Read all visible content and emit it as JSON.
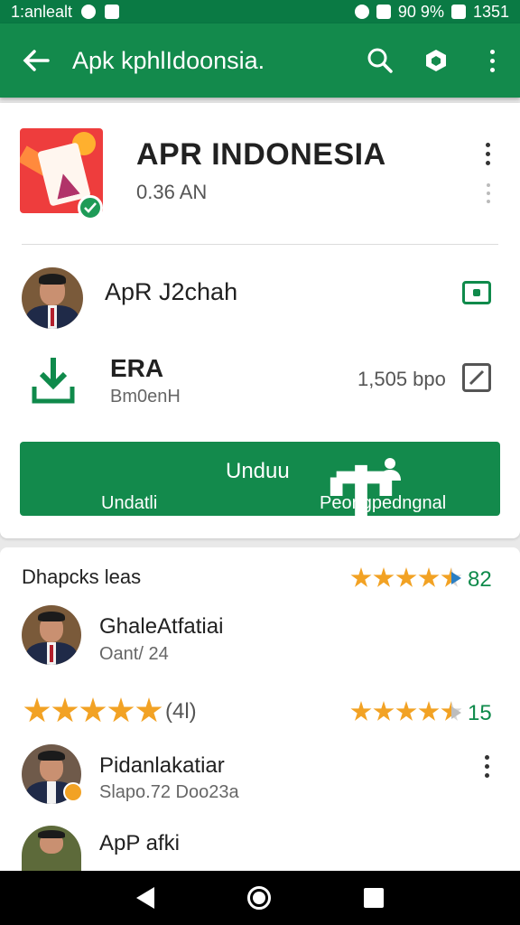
{
  "status_bar": {
    "carrier": "1:anlealt",
    "battery_percent": "90 9%",
    "time": "1351"
  },
  "app_bar": {
    "title": "Apk kphlIdoonsia."
  },
  "app": {
    "title": "APR  INDONESIA",
    "subtitle": "0.36 AN"
  },
  "developer": {
    "name": "ApR J2chah"
  },
  "download": {
    "title": "ERA",
    "subtitle": "Bm0enH",
    "size": "1,505 bpo"
  },
  "install_button": {
    "main_label": "Unduu",
    "left_label": "Undatli",
    "right_label": "Peongpedngnal"
  },
  "ratings": {
    "section_title": "Dhapcks leas",
    "summary_stars": 4.5,
    "summary_value": "82",
    "reviews": [
      {
        "name": "GhaleAtfatiai",
        "meta": "Oant/ 24"
      },
      {
        "stars": 5,
        "count": "(4l)",
        "stars_right": 4.5,
        "right_value": "15"
      },
      {
        "name": "Pidanlakatiar",
        "meta": "Slapo.72 Doo23a"
      },
      {
        "name": "ApP afki"
      }
    ]
  },
  "colors": {
    "primary": "#138a4c",
    "status": "#0a7a44",
    "star": "#f2a224",
    "accent_text": "#0f8a4b"
  }
}
